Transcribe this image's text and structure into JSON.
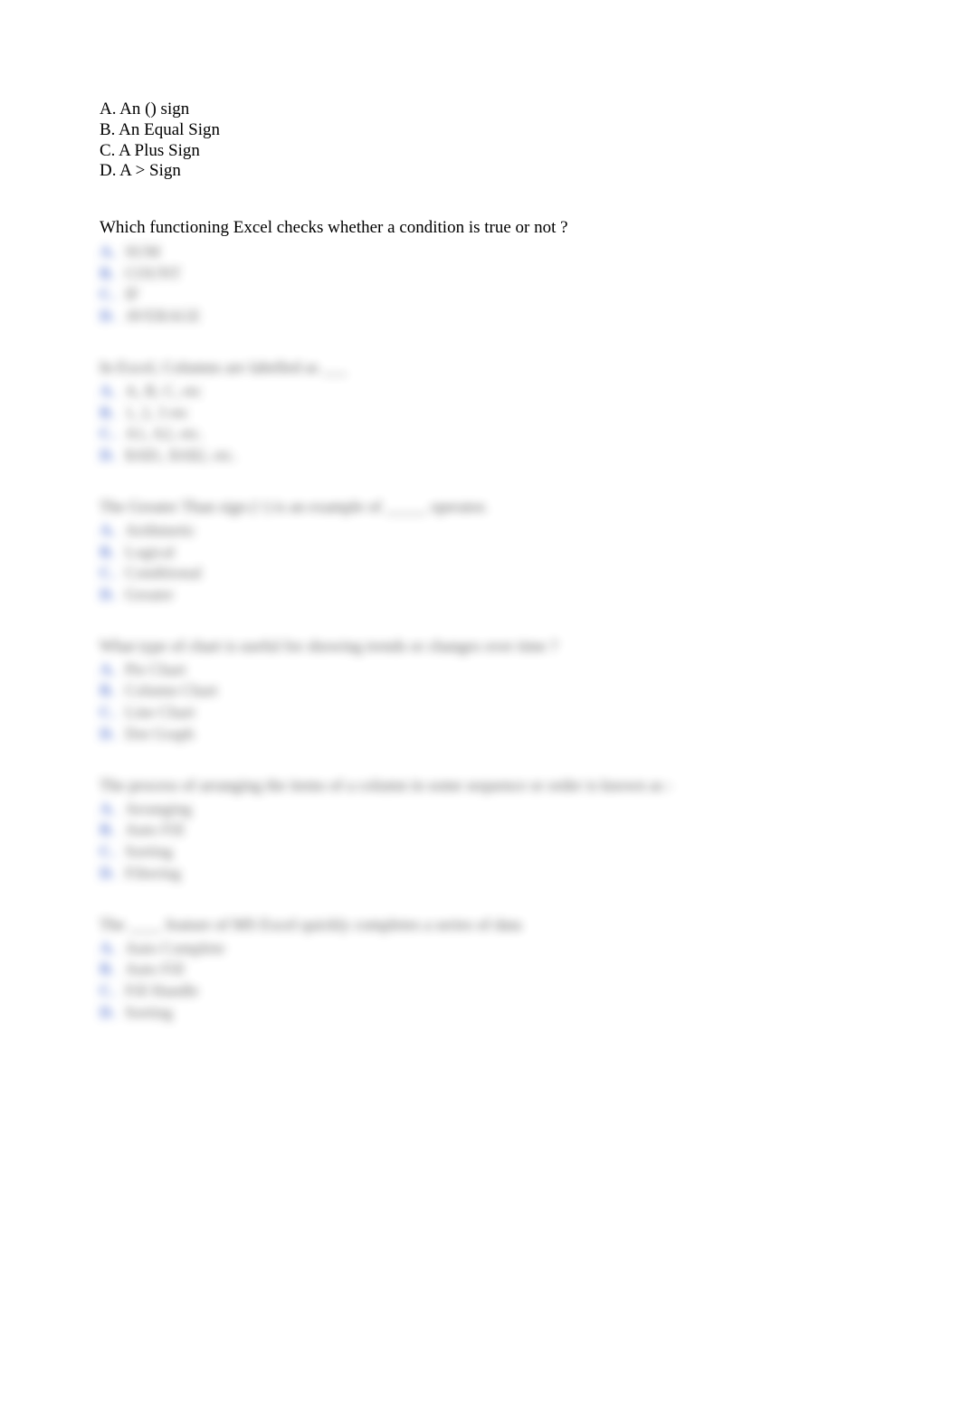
{
  "visible_question_options": {
    "a": "A. An () sign",
    "b": "B. An Equal Sign",
    "c": "C. A Plus Sign",
    "d": "D. A > Sign"
  },
  "visible_question2": "Which functioning Excel checks whether a condition is true or not ?",
  "blurred_sections": [
    {
      "prompt_lines": [],
      "options": [
        {
          "letter": "A.",
          "text": "SUM"
        },
        {
          "letter": "B.",
          "text": "COUNT"
        },
        {
          "letter": "C.",
          "text": "IF"
        },
        {
          "letter": "D.",
          "text": "AVERAGE"
        }
      ]
    },
    {
      "prompt_lines": [
        "In Excel, Columns are labelled as ___"
      ],
      "options": [
        {
          "letter": "A.",
          "text": "A, B, C, etc"
        },
        {
          "letter": "B.",
          "text": "1, 2, 3 etc"
        },
        {
          "letter": "C.",
          "text": "A1, A2, etc."
        },
        {
          "letter": "D.",
          "text": "$A$1, $A$2, etc."
        }
      ]
    },
    {
      "prompt_lines": [
        "The Greater Than sign (>) is an example of _____ operator."
      ],
      "options": [
        {
          "letter": "A.",
          "text": "Arithmetic"
        },
        {
          "letter": "B.",
          "text": "Logical"
        },
        {
          "letter": "C.",
          "text": "Conditional"
        },
        {
          "letter": "D.",
          "text": "Greater"
        }
      ]
    },
    {
      "prompt_lines": [
        "What type of chart is useful for showing trends or changes over time ?"
      ],
      "options": [
        {
          "letter": "A.",
          "text": "Pie Chart"
        },
        {
          "letter": "B.",
          "text": "Column Chart"
        },
        {
          "letter": "C.",
          "text": "Line Chart"
        },
        {
          "letter": "D.",
          "text": "Dot Graph"
        }
      ]
    },
    {
      "prompt_lines": [
        "The process of arranging the items of a column in some sequence or order is known as :"
      ],
      "options": [
        {
          "letter": "A.",
          "text": "Arranging"
        },
        {
          "letter": "B.",
          "text": "Auto Fill"
        },
        {
          "letter": "C.",
          "text": "Sorting"
        },
        {
          "letter": "D.",
          "text": "Filtering"
        }
      ]
    },
    {
      "prompt_lines": [
        "The ____ feature of MS Excel quickly completes a series of data"
      ],
      "options": [
        {
          "letter": "A.",
          "text": "Auto Complete"
        },
        {
          "letter": "B.",
          "text": "Auto Fill"
        },
        {
          "letter": "C.",
          "text": "Fill Handle"
        },
        {
          "letter": "D.",
          "text": "Sorting"
        }
      ]
    }
  ]
}
